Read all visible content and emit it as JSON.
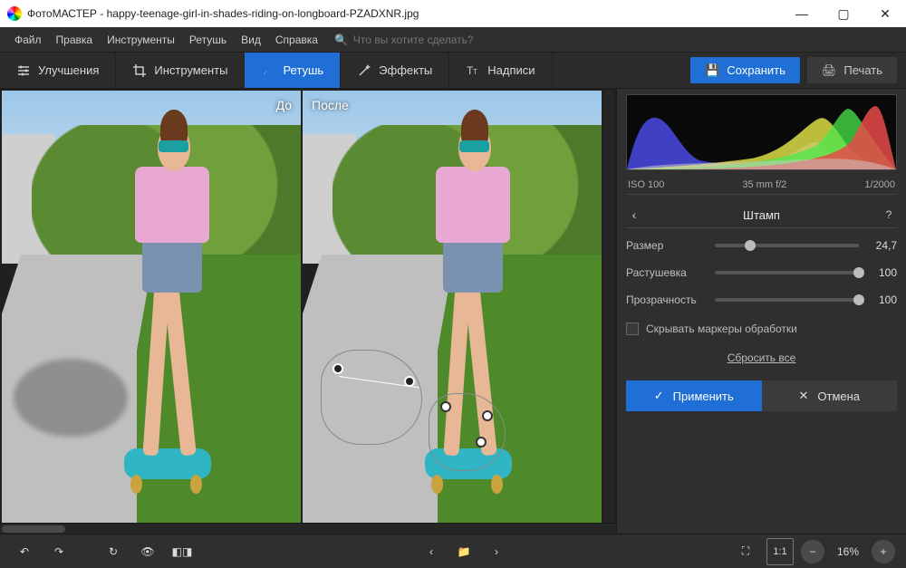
{
  "window": {
    "app_name": "ФотоМАСТЕР",
    "file_name": "happy-teenage-girl-in-shades-riding-on-longboard-PZADXNR.jpg"
  },
  "menubar": {
    "items": [
      "Файл",
      "Правка",
      "Инструменты",
      "Ретушь",
      "Вид",
      "Справка"
    ],
    "search_placeholder": "Что вы хотите сделать?"
  },
  "tool_tabs": {
    "items": [
      {
        "label": "Улучшения",
        "icon": "sliders-icon"
      },
      {
        "label": "Инструменты",
        "icon": "crop-icon"
      },
      {
        "label": "Ретушь",
        "icon": "brush-icon",
        "active": true
      },
      {
        "label": "Эффекты",
        "icon": "wand-icon"
      },
      {
        "label": "Надписи",
        "icon": "text-icon"
      }
    ],
    "save_label": "Сохранить",
    "print_label": "Печать"
  },
  "canvas": {
    "before_label": "До",
    "after_label": "После"
  },
  "exif": {
    "iso": "ISO 100",
    "focal": "35 mm f/2",
    "shutter": "1/2000"
  },
  "panel": {
    "title": "Штамп",
    "sliders": [
      {
        "label": "Размер",
        "value": "24,7",
        "pct": 24.7
      },
      {
        "label": "Растушевка",
        "value": "100",
        "pct": 100
      },
      {
        "label": "Прозрачность",
        "value": "100",
        "pct": 100
      }
    ],
    "hide_markers_label": "Скрывать маркеры обработки",
    "reset_label": "Сбросить все",
    "apply_label": "Применить",
    "cancel_label": "Отмена"
  },
  "bottombar": {
    "zoom": "16%"
  }
}
